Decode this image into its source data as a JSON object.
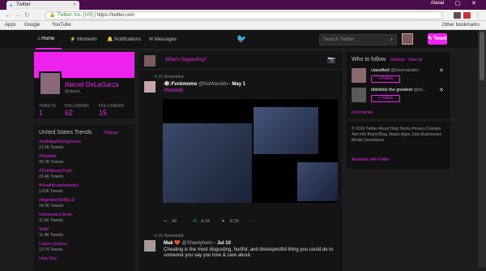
{
  "window": {
    "tab_title": "Twitter",
    "user_name": "Alacel",
    "controls": "– ▢ ✕"
  },
  "addressbar": {
    "org": "Twitter, Inc. [US]",
    "url": "https://twitter.com"
  },
  "bookmarks": {
    "apps": "Apps",
    "google": "Google",
    "youtube": "YouTube",
    "other": "Other bookmarks"
  },
  "nav": {
    "home": "Home",
    "moments": "Moments",
    "notifications": "Notifications",
    "messages": "Messages",
    "search_placeholder": "Search Twitter",
    "tweet_button": "Tweet"
  },
  "profile": {
    "name": "Alaciel DeLaGarza",
    "handle": "@alacel_",
    "tweets_label": "TWEETS",
    "tweets": "1",
    "following_label": "FOLLOWING",
    "following": "62",
    "followers_label": "FOLLOWERS",
    "followers": "15"
  },
  "trends": {
    "title": "United States Trends",
    "change": "Change",
    "items": [
      {
        "tag": "#HolidayPickUpLines",
        "count": "21.5K Tweets"
      },
      {
        "tag": "#1bstells",
        "count": "40.7K Tweets"
      },
      {
        "tag": "#TheMessyTruth",
        "count": "23.4K Tweets"
      },
      {
        "tag": "#HowIKnowImAwful",
        "count": "1,636 Tweets"
      },
      {
        "tag": "#AgentsofSHIELD",
        "count": "24.3K Tweets"
      },
      {
        "tag": "Indonesia's Aceh",
        "count": "11.6K Tweets"
      },
      {
        "tag": "Soler",
        "count": "11.4K Tweets"
      },
      {
        "tag": "Carlos Gomez",
        "count": "2,574 Tweets"
      },
      {
        "tag": "Inna Goy",
        "count": ""
      }
    ]
  },
  "composer": {
    "placeholder": "What's happening?"
  },
  "tweet1": {
    "retweeted_by": "21 Retweeted",
    "name": "🕸:Fvckmomo",
    "handle": "@NoHoesMo",
    "date": "May 1",
    "tag": "#Nerdalti",
    "replies": "40",
    "retweets": "4.1K",
    "likes": "8.2K"
  },
  "tweet2": {
    "retweeted_by": "21 Retweeted",
    "name": "Mak ❤️",
    "handle": "@Shawlyfeels",
    "date": "Jul 10",
    "text": "Cheating is the most disgusting, hurtful, and disrespectful thing you could do to someone you say you love & care about."
  },
  "who_to_follow": {
    "title": "Who to follow",
    "refresh": "Refresh",
    "view_all": "View all",
    "follow_label": "Follow",
    "items": [
      {
        "name": "classified",
        "handle": "@futurodudeo"
      },
      {
        "name": "iddobbiz the greatest",
        "handle": "@du..."
      }
    ],
    "find_friends": "Find friends"
  },
  "footer": {
    "text": "© 2016 Twitter  About  Help  Terms  Privacy  Cookies  Ads info  Brand  Blog  Status  Apps  Jobs  Businesses  Media  Developers",
    "advertise": "Advertise with Twitter"
  },
  "colors": {
    "accent": "#ee22ee",
    "background": "#1c1c1c",
    "panel": "#141414"
  }
}
